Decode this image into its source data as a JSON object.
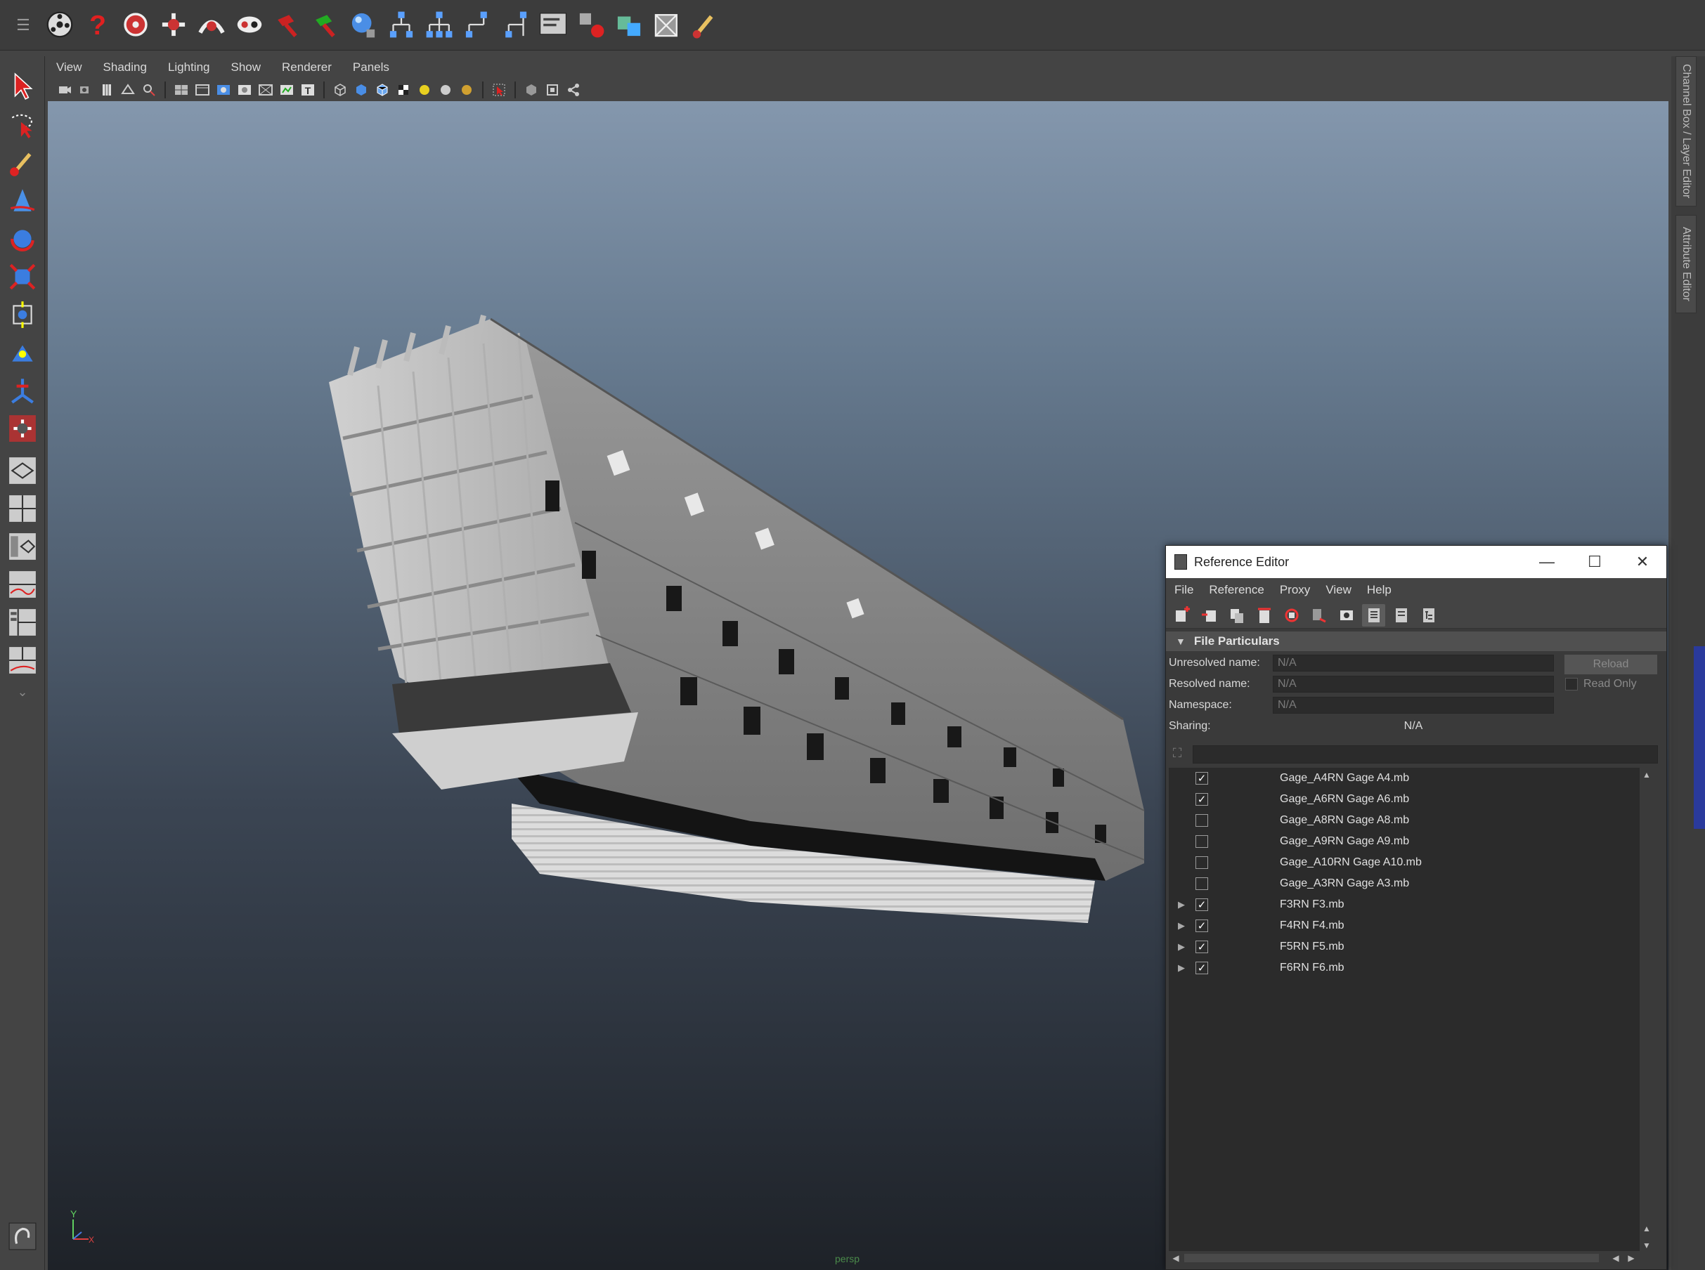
{
  "panel_menu": [
    "View",
    "Shading",
    "Lighting",
    "Show",
    "Renderer",
    "Panels"
  ],
  "side_tabs": {
    "channel_box": "Channel Box / Layer Editor",
    "attribute_editor": "Attribute Editor"
  },
  "viewport": {
    "camera": "persp",
    "axis_y": "Y",
    "axis_x": "X"
  },
  "reference_editor": {
    "title": "Reference Editor",
    "menu": [
      "File",
      "Reference",
      "Proxy",
      "View",
      "Help"
    ],
    "section_title": "File Particulars",
    "unresolved_label": "Unresolved name:",
    "unresolved_value": "N/A",
    "resolved_label": "Resolved name:",
    "resolved_value": "N/A",
    "namespace_label": "Namespace:",
    "namespace_value": "N/A",
    "sharing_label": "Sharing:",
    "sharing_value": "N/A",
    "reload_label": "Reload",
    "read_only_label": "Read Only",
    "references": [
      {
        "name": "Gage_A4RN Gage A4.mb",
        "checked": true,
        "expandable": false
      },
      {
        "name": "Gage_A6RN Gage A6.mb",
        "checked": true,
        "expandable": false
      },
      {
        "name": "Gage_A8RN Gage A8.mb",
        "checked": false,
        "expandable": false
      },
      {
        "name": "Gage_A9RN Gage A9.mb",
        "checked": false,
        "expandable": false
      },
      {
        "name": "Gage_A10RN Gage A10.mb",
        "checked": false,
        "expandable": false
      },
      {
        "name": "Gage_A3RN Gage A3.mb",
        "checked": false,
        "expandable": false
      },
      {
        "name": "F3RN F3.mb",
        "checked": true,
        "expandable": true
      },
      {
        "name": "F4RN F4.mb",
        "checked": true,
        "expandable": true
      },
      {
        "name": "F5RN F5.mb",
        "checked": true,
        "expandable": true
      },
      {
        "name": "F6RN F6.mb",
        "checked": true,
        "expandable": true
      }
    ]
  },
  "colors": {
    "viewport_top": "#8497ad",
    "viewport_bottom": "#1e2228",
    "ui_bg": "#444444",
    "field_bg": "#2b2b2b",
    "side_accent": "#2a3a9c"
  }
}
